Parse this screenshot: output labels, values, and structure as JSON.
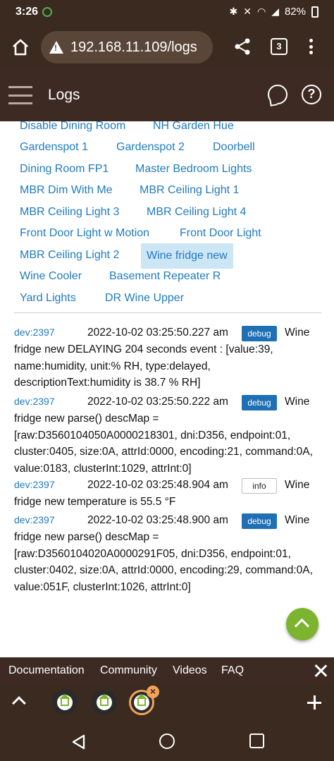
{
  "status_bar": {
    "time": "3:26",
    "battery": "82%"
  },
  "browser": {
    "url": "192.168.11.109/logs",
    "tab_count": "3"
  },
  "header": {
    "title": "Logs"
  },
  "devices": [
    {
      "label": "Disable Dining Room"
    },
    {
      "label": "NH Garden Hue"
    },
    {
      "label": "Gardenspot 1"
    },
    {
      "label": "Gardenspot 2"
    },
    {
      "label": "Doorbell"
    },
    {
      "label": "Dining Room FP1"
    },
    {
      "label": "Master Bedroom Lights"
    },
    {
      "label": "MBR Dim With Me"
    },
    {
      "label": "MBR Ceiling Light 1"
    },
    {
      "label": "MBR Ceiling Light 3"
    },
    {
      "label": "MBR Ceiling Light 4"
    },
    {
      "label": "Front Door Light w Motion"
    },
    {
      "label": "Front Door Light"
    },
    {
      "label": "MBR Ceiling Light 2"
    },
    {
      "label": "Wine fridge new",
      "selected": true
    },
    {
      "label": "Wine Cooler"
    },
    {
      "label": "Basement Repeater R"
    },
    {
      "label": "Yard Lights"
    },
    {
      "label": "DR Wine Upper"
    }
  ],
  "logs": [
    {
      "dev": "dev:2397",
      "timestamp": "2022-10-02 03:25:50.227 am",
      "level": "debug",
      "name_first": "Wine",
      "message": "fridge new DELAYING 204 seconds event : [value:39, name:humidity, unit:% RH, type:delayed, descriptionText:humidity is 38.7 % RH]"
    },
    {
      "dev": "dev:2397",
      "timestamp": "2022-10-02 03:25:50.222 am",
      "level": "debug",
      "name_first": "Wine",
      "message": "fridge new parse() descMap = [raw:D3560104050A0000218301, dni:D356, endpoint:01, cluster:0405, size:0A, attrId:0000, encoding:21, command:0A, value:0183, clusterInt:1029, attrInt:0]"
    },
    {
      "dev": "dev:2397",
      "timestamp": "2022-10-02 03:25:48.904 am",
      "level": "info",
      "name_first": "Wine",
      "message": "fridge new temperature is 55.5 °F"
    },
    {
      "dev": "dev:2397",
      "timestamp": "2022-10-02 03:25:48.900 am",
      "level": "debug",
      "name_first": "Wine",
      "message": "fridge new parse() descMap = [raw:D3560104020A0000291F05, dni:D356, endpoint:01, cluster:0402, size:0A, attrId:0000, encoding:29, command:0A, value:051F, clusterInt:1026, attrInt:0]"
    }
  ],
  "bottom_links": {
    "documentation": "Documentation",
    "community": "Community",
    "videos": "Videos",
    "faq": "FAQ"
  },
  "bubble_close_label": "×",
  "colors": {
    "link": "#1f7bbf",
    "debug_badge": "#1f6fb5",
    "header_bg": "#3d2b23",
    "fab": "#7cb42f"
  }
}
